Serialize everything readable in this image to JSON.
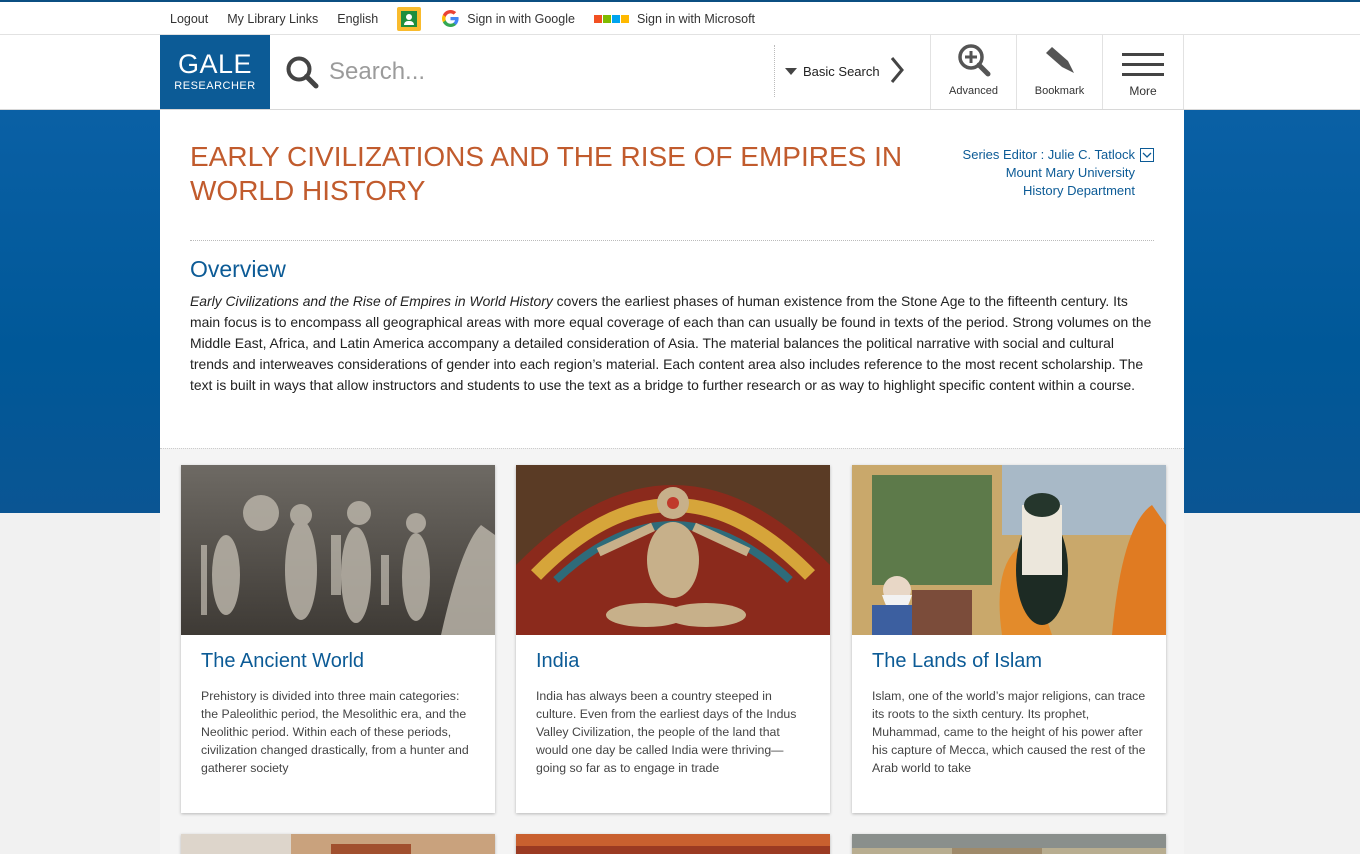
{
  "util_bar": {
    "logout": "Logout",
    "library_links": "My Library Links",
    "language": "English",
    "google_signin": "Sign in with Google",
    "microsoft_signin": "Sign in with Microsoft"
  },
  "header": {
    "logo_line1": "GALE",
    "logo_line2": "RESEARCHER",
    "search_placeholder": "Search...",
    "search_mode": "Basic Search",
    "advanced": "Advanced",
    "bookmark": "Bookmark",
    "more": "More"
  },
  "page": {
    "title": "EARLY CIVILIZATIONS AND THE RISE OF EMPIRES IN WORLD HISTORY",
    "editor_label": "Series Editor : Julie C. Tatlock",
    "editor_institution": "Mount Mary University",
    "editor_department": "History Department",
    "overview_heading": "Overview",
    "overview_italic": "Early Civilizations and the Rise of Empires in World History",
    "overview_text": " covers the earliest phases of human existence from the Stone Age to the fifteenth century. Its main focus is to encompass all geographical areas with more equal coverage of each than can usually be found in texts of the period. Strong volumes on the Middle East, Africa, and Latin America accompany a detailed consideration of Asia. The material balances the political narrative with social and cultural trends and interweaves considerations of gender into each region’s material. Each content area also includes reference to the most recent scholarship. The text is built in ways that allow instructors and students to use the text as a bridge to further research or as way to highlight specific content within a course."
  },
  "cards": [
    {
      "title": "The Ancient World",
      "summary": "Prehistory is divided into three main categories: the Paleolithic period, the Mesolithic era, and the Neolithic period. Within each of these periods, civilization changed drastically, from a hunter and gatherer society"
    },
    {
      "title": "India",
      "summary": "India has always been a country steeped in culture. Even from the earliest days of the Indus Valley Civilization, the people of the land that would one day be called India were thriving—going so far as to engage in trade"
    },
    {
      "title": "The Lands of Islam",
      "summary": "Islam, one of the world’s major religions, can trace its roots to the sixth century. Its prophet, Muhammad, came to the height of his power after his capture of Mecca, which caused the rest of the Arab world to take"
    }
  ],
  "colors": {
    "brand_blue": "#0c5b96",
    "title_orange": "#c15b2d"
  }
}
